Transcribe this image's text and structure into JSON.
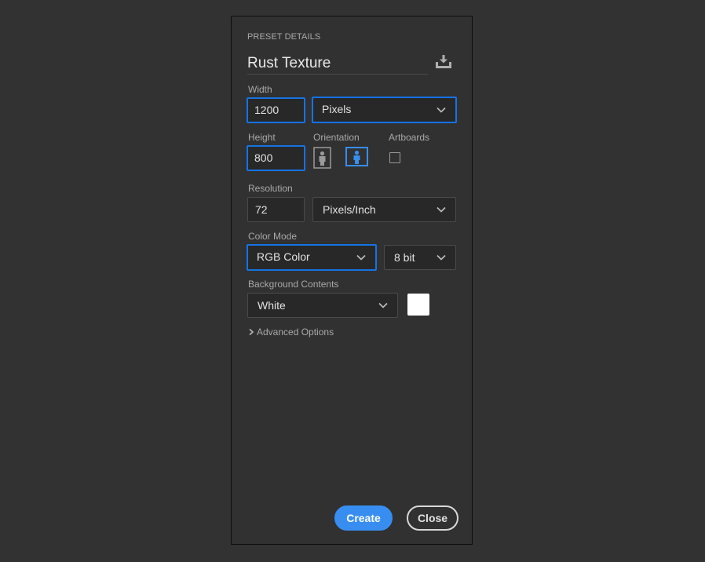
{
  "preset": {
    "section_title": "PRESET DETAILS",
    "name": "Rust Texture",
    "save_icon": "download-preset-icon"
  },
  "width": {
    "label": "Width",
    "value": "1200",
    "unit": "Pixels"
  },
  "height": {
    "label": "Height",
    "value": "800"
  },
  "orientation": {
    "label": "Orientation",
    "selected": "landscape"
  },
  "artboards": {
    "label": "Artboards",
    "checked": false
  },
  "resolution": {
    "label": "Resolution",
    "value": "72",
    "unit": "Pixels/Inch"
  },
  "color_mode": {
    "label": "Color Mode",
    "mode": "RGB Color",
    "depth": "8 bit"
  },
  "background": {
    "label": "Background Contents",
    "value": "White",
    "swatch_color": "#ffffff"
  },
  "advanced": {
    "label": "Advanced Options"
  },
  "buttons": {
    "create": "Create",
    "close": "Close"
  },
  "colors": {
    "accent": "#1473e6",
    "create_button": "#378ef0"
  }
}
